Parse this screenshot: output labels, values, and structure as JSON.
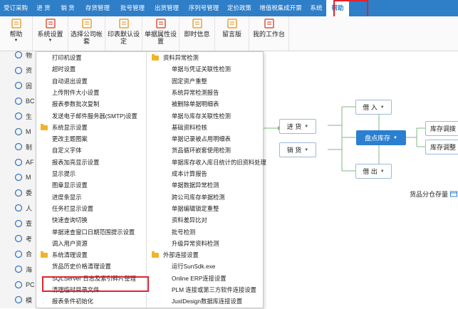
{
  "menubar": {
    "items": [
      "受订采购",
      "进 货",
      "销 货",
      "存货管理",
      "批号管理",
      "出货管理",
      "序列号管理",
      "定价政策",
      "增值税集成开票",
      "系统",
      "帮助"
    ],
    "active": "帮助"
  },
  "toolbar": {
    "buttons": [
      {
        "label": "帮助",
        "icon": "help-book-icon",
        "dropdown": true
      },
      {
        "label": "系统设置",
        "icon": "settings-table-icon",
        "dropdown": true
      },
      {
        "label": "选择公司帐套",
        "icon": "company-account-icon",
        "dropdown": false
      },
      {
        "label": "印表默认设定",
        "icon": "print-default-icon",
        "dropdown": false
      },
      {
        "label": "单据属性设置",
        "icon": "document-property-icon",
        "dropdown": false
      },
      {
        "label": "即时信息",
        "icon": "instant-message-icon",
        "dropdown": false
      },
      {
        "label": "留言版",
        "icon": "message-board-icon",
        "dropdown": false
      },
      {
        "label": "我的工作台",
        "icon": "workbench-icon",
        "dropdown": false
      }
    ]
  },
  "sidebar": {
    "items": [
      {
        "label": "物",
        "icon": "home-icon"
      },
      {
        "label": "资",
        "icon": "person-icon"
      },
      {
        "label": "固",
        "icon": "clock-icon"
      },
      {
        "label": "BC",
        "icon": "calculator-icon"
      },
      {
        "label": "生",
        "icon": "gear-icon"
      },
      {
        "label": "M",
        "icon": "monitor-icon"
      },
      {
        "label": "制",
        "icon": "box-icon"
      },
      {
        "label": "AF",
        "icon": "clock-icon"
      },
      {
        "label": "M",
        "icon": "mail-icon"
      },
      {
        "label": "委",
        "icon": "shuffle-icon"
      },
      {
        "label": "人",
        "icon": "users-icon"
      },
      {
        "label": "查",
        "icon": "search-icon"
      },
      {
        "label": "考",
        "icon": "calendar-icon"
      },
      {
        "label": "合",
        "icon": "grid-icon"
      },
      {
        "label": "海",
        "icon": "ship-icon"
      },
      {
        "label": "PC",
        "icon": "pc-icon"
      },
      {
        "label": "模",
        "icon": "module-icon"
      }
    ]
  },
  "dropdown": {
    "left_column": [
      {
        "label": "打印机设置",
        "type": "item"
      },
      {
        "label": "超时设置",
        "type": "item"
      },
      {
        "label": "自动退出设置",
        "type": "item"
      },
      {
        "label": "上传附件大小设置",
        "type": "item"
      },
      {
        "label": "报表参数批次复制",
        "type": "item"
      },
      {
        "label": "发送电子邮件服务器(SMTP)设置",
        "type": "item"
      },
      {
        "label": "系统显示设置",
        "type": "group"
      },
      {
        "label": "更改主题图案",
        "type": "item"
      },
      {
        "label": "自定义字体",
        "type": "item"
      },
      {
        "label": "报表加亮显示设置",
        "type": "item"
      },
      {
        "label": "显示提示",
        "type": "item"
      },
      {
        "label": "图章显示设置",
        "type": "item"
      },
      {
        "label": "进度条显示",
        "type": "item"
      },
      {
        "label": "任务栏显示设置",
        "type": "item"
      },
      {
        "label": "快速查询切换",
        "type": "item"
      },
      {
        "label": "单据速查窗口日期范围提示设置",
        "type": "item"
      },
      {
        "label": "调入用户资源",
        "type": "item"
      },
      {
        "label": "系统清理设置",
        "type": "group"
      },
      {
        "label": "货品历史价格清理设置",
        "type": "item"
      },
      {
        "label": "SQLServer 日志及索引碎片整理",
        "type": "item"
      },
      {
        "label": "清理临时目录文件",
        "type": "item"
      },
      {
        "label": "报表条件初始化",
        "type": "item"
      }
    ],
    "right_column": [
      {
        "label": "资料异常检测",
        "type": "group"
      },
      {
        "label": "单据与凭证关联性检测",
        "type": "item"
      },
      {
        "label": "固定资产重整",
        "type": "item"
      },
      {
        "label": "系统异常检测报告",
        "type": "item"
      },
      {
        "label": "被删除单据明细表",
        "type": "item"
      },
      {
        "label": "单据与库存关联性检测",
        "type": "item"
      },
      {
        "label": "基础资料检核",
        "type": "item"
      },
      {
        "label": "单据记录被占用明细表",
        "type": "item"
      },
      {
        "label": "货品循环嵌套使用检测",
        "type": "item"
      },
      {
        "label": "单据库存收入库日统计的旧资料处理",
        "type": "item"
      },
      {
        "label": "成本计算报告",
        "type": "item"
      },
      {
        "label": "单据数据异常检测",
        "type": "item"
      },
      {
        "label": "跨公司库存单据检测",
        "type": "item"
      },
      {
        "label": "单据编辑锁定重整",
        "type": "item"
      },
      {
        "label": "资料差异比对",
        "type": "item"
      },
      {
        "label": "批号检测",
        "type": "item"
      },
      {
        "label": "升级异常资料检测",
        "type": "item"
      },
      {
        "label": "外部连接设置",
        "type": "group"
      },
      {
        "label": "运行SunSdk.exe",
        "type": "item"
      },
      {
        "label": "Online  ERP连接设置",
        "type": "item"
      },
      {
        "label": "PLM 连接或第三方软件连接设置",
        "type": "item"
      },
      {
        "label": "JustDesign数据库连接设置",
        "type": "item"
      }
    ]
  },
  "flow": {
    "borrow_in": "借 入",
    "purchase": "进 货",
    "sale": "销 货",
    "inventory_count": "盘点库存",
    "borrow_out": "借 出",
    "stock_transfer": "库存调拨",
    "stock_adjust": "库存调整",
    "goods_storage": "货品分仓存量"
  },
  "colors": {
    "menubar": "#2e7ec8",
    "highlight": "#e0242d",
    "primary_box": "#2b7fd1",
    "folder": "#f0b429"
  }
}
